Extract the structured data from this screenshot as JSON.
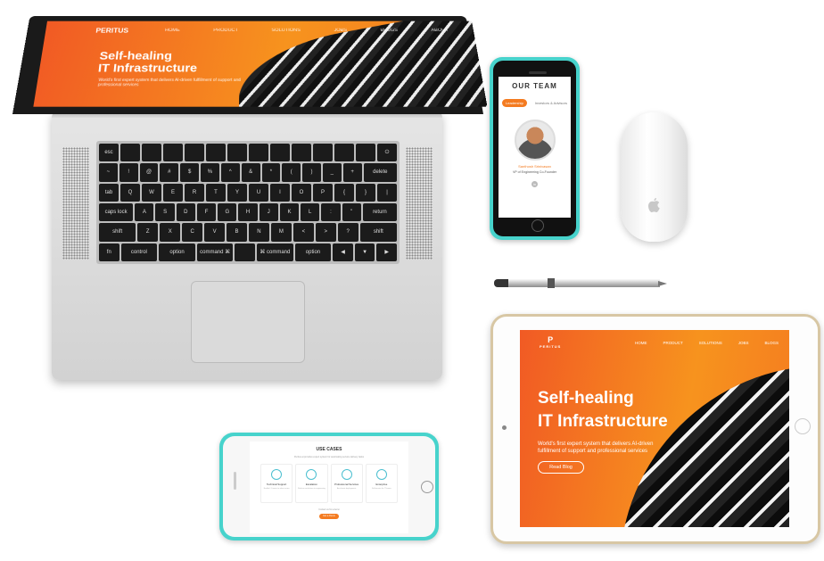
{
  "laptop": {
    "logo": "PERITUS",
    "nav": [
      "HOME",
      "PRODUCT",
      "SOLUTIONS",
      "JOBS",
      "BLOGS",
      "ABOUT"
    ],
    "hero_line1": "Self-healing",
    "hero_line2": "IT Infrastructure",
    "subtitle": "World's first expert system that delivers AI-driven fulfillment of support and professional services"
  },
  "keyboard": {
    "row1": [
      "esc",
      "",
      "",
      "",
      "",
      "",
      "",
      "",
      "",
      "",
      "",
      "",
      "",
      "⏻"
    ],
    "row2": [
      "~",
      "!",
      "@",
      "#",
      "$",
      "%",
      "^",
      "&",
      "*",
      "(",
      ")",
      "_",
      "+",
      "delete"
    ],
    "row3": [
      "tab",
      "Q",
      "W",
      "E",
      "R",
      "T",
      "Y",
      "U",
      "I",
      "O",
      "P",
      "{",
      "}",
      "|"
    ],
    "row4": [
      "caps lock",
      "A",
      "S",
      "D",
      "F",
      "G",
      "H",
      "J",
      "K",
      "L",
      ":",
      "\"",
      "return"
    ],
    "row5": [
      "shift",
      "Z",
      "X",
      "C",
      "V",
      "B",
      "N",
      "M",
      "<",
      ">",
      "?",
      "shift"
    ],
    "row6": [
      "fn",
      "control",
      "option",
      "command ⌘",
      "",
      "⌘ command",
      "option",
      "◀",
      "▼",
      "▶"
    ]
  },
  "phone_portrait": {
    "title": "OUR TEAM",
    "tab_active": "Leadership",
    "tab_other": "Investors & Advisors",
    "person_name": "Santhosh Srinivasan",
    "person_role": "VP of Engineering Co-Founder",
    "social": "in"
  },
  "mouse": {
    "logo_icon": "apple-icon",
    "logo_glyph": ""
  },
  "tablet": {
    "logo": "P",
    "logo_sub": "PERITUS",
    "nav": [
      "HOME",
      "PRODUCT",
      "SOLUTIONS",
      "JOBS",
      "BLOGS"
    ],
    "hero_line1": "Self-healing",
    "hero_line2": "IT Infrastructure",
    "subtitle": "World's first expert system that delivers AI-driven fulfillment of support and professional services",
    "cta": "Read Blog"
  },
  "phone_landscape": {
    "title": "USE CASES",
    "subtitle": "Peritus.ai provides expert system for automating service delivery tasks",
    "cards": [
      {
        "label": "Technical Support",
        "text": "Enable L1 teams to solve issues"
      },
      {
        "label": "Escalation",
        "text": "Reduce escalations to engineering"
      },
      {
        "label": "Professional Services",
        "text": "Accelerate deployments"
      },
      {
        "label": "Enterprise",
        "text": "Self-service for IT teams"
      }
    ],
    "link_text": "Contact us for a demo",
    "cta": "Get a Demo"
  },
  "colors": {
    "brand_orange": "#f47b20",
    "device_teal": "#47d3cc"
  }
}
